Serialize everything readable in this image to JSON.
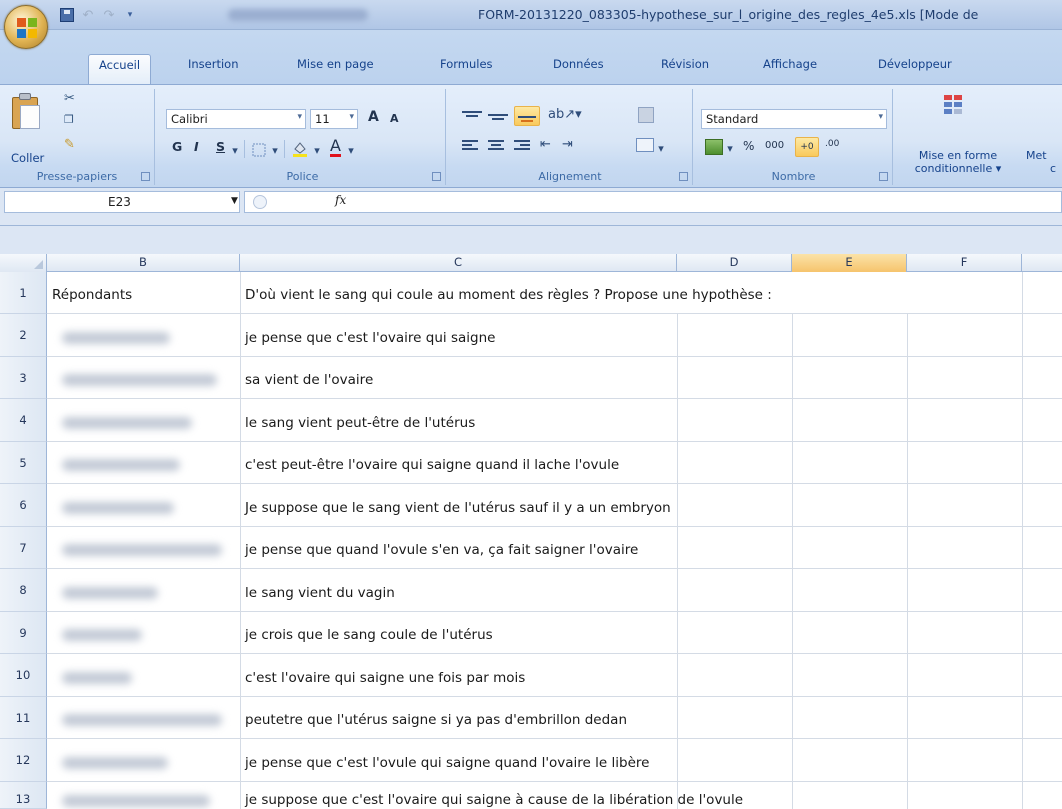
{
  "window": {
    "title": "FORM-20131220_083305-hypothese_sur_l_origine_des_regles_4e5.xls  [Mode de"
  },
  "ribbon": {
    "tabs": [
      {
        "label": "Accueil",
        "active": true
      },
      {
        "label": "Insertion"
      },
      {
        "label": "Mise en page"
      },
      {
        "label": "Formules"
      },
      {
        "label": "Données"
      },
      {
        "label": "Révision"
      },
      {
        "label": "Affichage"
      },
      {
        "label": "Développeur"
      }
    ],
    "clipboard": {
      "paste_label": "Coller",
      "group_label": "Presse-papiers"
    },
    "font": {
      "name": "Calibri",
      "size": "11",
      "bold": "G",
      "italic": "I",
      "underline": "S",
      "grow": "A",
      "shrink": "A",
      "font_color_glyph": "A",
      "group_label": "Police"
    },
    "alignment": {
      "group_label": "Alignement"
    },
    "number": {
      "format": "Standard",
      "percent": "%",
      "thousands": "000",
      "group_label": "Nombre"
    },
    "styles": {
      "cond_format_label_1": "Mise en forme",
      "cond_format_label_2": "conditionnelle",
      "next_label_1": "Met",
      "next_label_2": "c"
    }
  },
  "formula_bar": {
    "name_box": "E23",
    "fx": "fx",
    "formula": ""
  },
  "sheet": {
    "columns": [
      "B",
      "C",
      "D",
      "E",
      "F"
    ],
    "selected_column": "E",
    "header_cell": {
      "b": "Répondants",
      "c": "D'où vient le sang qui coule au moment des règles ? Propose une hypothèse :"
    },
    "rows": [
      {
        "num": "1"
      },
      {
        "num": "2",
        "answer": "je pense que c'est l'ovaire qui saigne"
      },
      {
        "num": "3",
        "answer": "sa vient de l'ovaire"
      },
      {
        "num": "4",
        "answer": "le sang vient peut-être de l'utérus"
      },
      {
        "num": "5",
        "answer": "c'est peut-être l'ovaire qui saigne quand il lache l'ovule"
      },
      {
        "num": "6",
        "answer": "Je suppose que le sang vient de l'utérus sauf il y a un embryon"
      },
      {
        "num": "7",
        "answer": "je pense que quand l'ovule s'en va, ça fait saigner l'ovaire"
      },
      {
        "num": "8",
        "answer": "le sang vient du vagin"
      },
      {
        "num": "9",
        "answer": "je crois que le sang coule de l'utérus"
      },
      {
        "num": "10",
        "answer": "c'est l'ovaire qui saigne une fois par mois"
      },
      {
        "num": "11",
        "answer": "peutetre que l'utérus saigne si ya pas d'embrillon dedan"
      },
      {
        "num": "12",
        "answer": "je pense que c'est l'ovule qui saigne quand l'ovaire le libère"
      },
      {
        "num": "13",
        "answer": "je suppose que c'est l'ovaire qui saigne à cause de la libération de l'ovule"
      }
    ]
  }
}
